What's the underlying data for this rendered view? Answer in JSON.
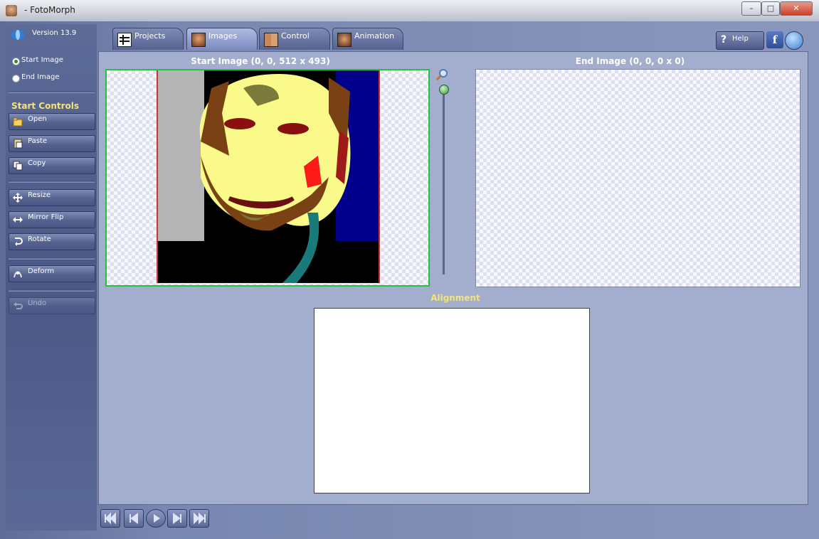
{
  "window": {
    "title": "- FotoMorph",
    "minimize": "–",
    "maximize": "□",
    "close": "✕"
  },
  "sidebar": {
    "version": "Version 13.9",
    "radio_start": "Start Image",
    "radio_end": "End Image",
    "section_title": "Start Controls",
    "buttons": {
      "open": "Open",
      "paste": "Paste",
      "copy": "Copy",
      "resize": "Resize",
      "mirror": "Mirror Flip",
      "rotate": "Rotate",
      "deform": "Deform",
      "undo": "Undo"
    }
  },
  "tabs": [
    "Projects",
    "Images",
    "Control",
    "Animation"
  ],
  "header": {
    "help": "Help",
    "facebook": "f"
  },
  "main": {
    "start_title": "Start Image (0, 0, 512 x 493)",
    "end_title": "End Image (0, 0, 0 x 0)",
    "alignment_title": "Alignment"
  },
  "colors": {
    "accent_yellow": "#f3e47a",
    "selection_green": "#27c23b"
  }
}
